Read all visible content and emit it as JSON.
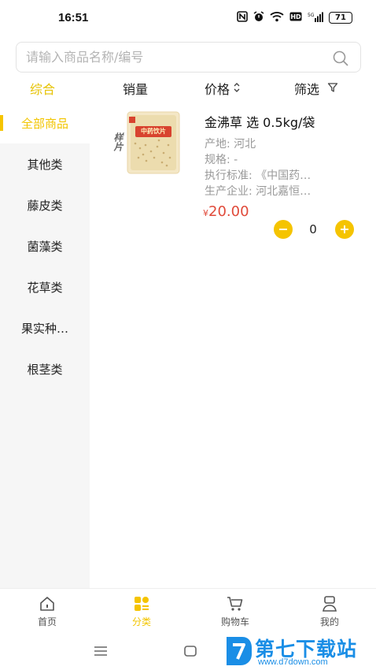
{
  "status_bar": {
    "time": "16:51",
    "icons": [
      "nfc-icon",
      "alarm-icon",
      "wifi-icon",
      "hd-icon",
      "signal-icon"
    ],
    "battery": "71"
  },
  "search": {
    "placeholder": "请输入商品名称/编号",
    "value": "",
    "icon": "search-icon"
  },
  "sort_bar": {
    "items": [
      {
        "label": "综合",
        "active": true
      },
      {
        "label": "销量",
        "active": false
      },
      {
        "label": "价格",
        "active": false,
        "icon": "sort-arrows-icon"
      },
      {
        "label": "筛选",
        "active": false,
        "icon": "filter-icon"
      }
    ]
  },
  "sidebar": {
    "items": [
      {
        "label": "全部商品",
        "active": true
      },
      {
        "label": "其他类"
      },
      {
        "label": "藤皮类"
      },
      {
        "label": "菌藻类"
      },
      {
        "label": "花草类"
      },
      {
        "label": "果实种…"
      },
      {
        "label": "根茎类"
      }
    ]
  },
  "products": [
    {
      "title": "金沸草 选 0.5kg/袋",
      "image_badge": "样片",
      "package_text": "中药饮片",
      "attrs": [
        "产地: 河北",
        "规格: -",
        "执行标准: 《中国药…",
        "生产企业: 河北嘉恒…"
      ],
      "currency": "¥",
      "price": "20.00",
      "quantity": "0"
    }
  ],
  "tab_bar": {
    "items": [
      {
        "label": "首页",
        "icon": "home-icon",
        "active": false
      },
      {
        "label": "分类",
        "icon": "category-icon",
        "active": true
      },
      {
        "label": "购物车",
        "icon": "cart-icon",
        "active": false
      },
      {
        "label": "我的",
        "icon": "profile-icon",
        "active": false
      }
    ]
  },
  "watermark": {
    "text": "第七下载站",
    "url": "www.d7down.com"
  },
  "colors": {
    "accent": "#f5c400",
    "price": "#e04a3a",
    "sidebar_bg": "#f6f6f6",
    "watermark": "#1a8ee6"
  }
}
